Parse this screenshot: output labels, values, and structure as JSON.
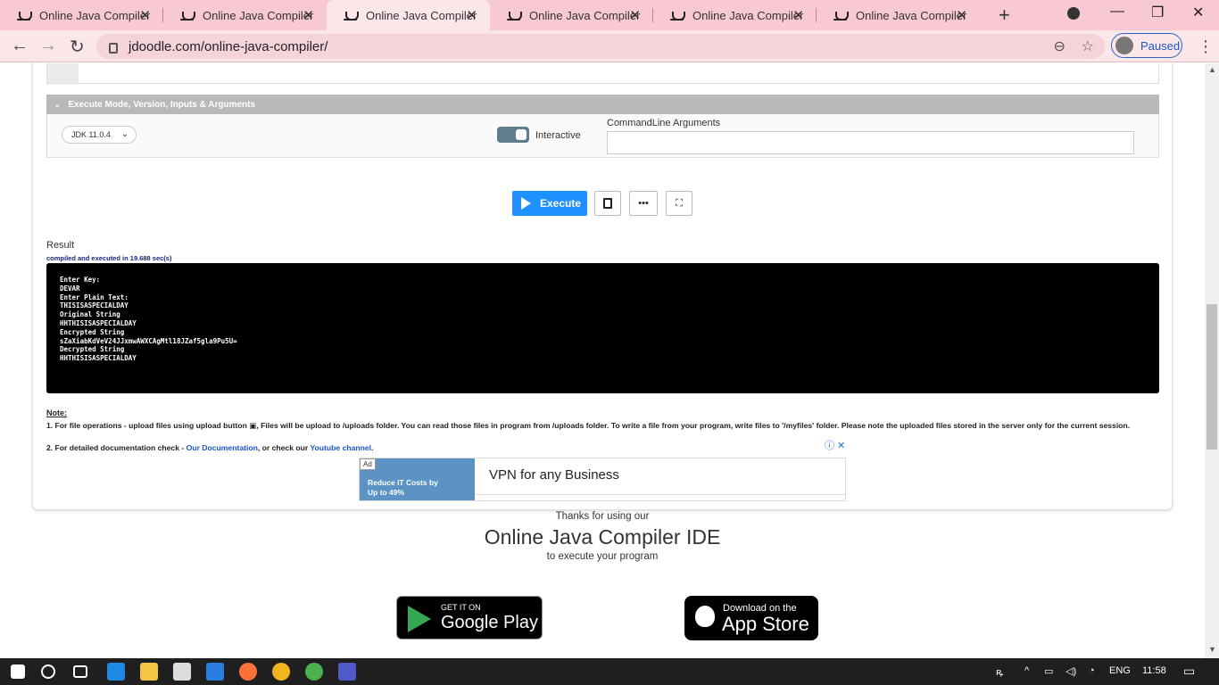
{
  "tabs": [
    {
      "label": "Online Java Compiler -",
      "active": false
    },
    {
      "label": "Online Java Compiler -",
      "active": false
    },
    {
      "label": "Online Java Compiler -",
      "active": true
    },
    {
      "label": "Online Java Compiler -",
      "active": false
    },
    {
      "label": "Online Java Compiler -",
      "active": false
    },
    {
      "label": "Online Java Compiler -",
      "active": false
    }
  ],
  "browser": {
    "url": "jdoodle.com/online-java-compiler/",
    "profile_status": "Paused",
    "new_tab": "+",
    "minimize": "—",
    "maximize": "❐",
    "close": "✕"
  },
  "execute_panel": {
    "heading": "Execute Mode, Version, Inputs & Arguments",
    "jdk_version": "JDK 11.0.4",
    "interactive_label": "Interactive",
    "interactive_on": true,
    "cmd_label": "CommandLine Arguments",
    "cmd_value": ""
  },
  "buttons": {
    "execute": "Execute",
    "more": "•••"
  },
  "result": {
    "label": "Result",
    "status": "compiled and executed in 19.688 sec(s)",
    "output_lines": [
      "Enter Key:",
      "DEVAR",
      "Enter Plain Text:",
      "THISISASPECIALDAY",
      "Original String",
      "HHTHISISASPECIALDAY",
      "Encrypted String",
      "sZaXiabKdVeV24JJxmwAWXCAgMtl18JZaf5gla9Pu5U=",
      "Decrypted String",
      "HHTHISISASPECIALDAY"
    ]
  },
  "notes": {
    "label": "Note:",
    "line1": "1. For file operations - upload files using upload button ▣, Files will be upload to /uploads folder. You can read those files in program from /uploads folder. To write a file from your program, write files to '/myfiles' folder. Please note the uploaded files stored in the server only for the current session.",
    "line2_prefix": "2. For detailed documentation check - ",
    "line2_link1": "Our Documentation",
    "line2_mid": ", or check our ",
    "line2_link2": "Youtube channel",
    "line2_suffix": "."
  },
  "ad": {
    "badge": "Ad",
    "image_text": "Reduce IT Costs by Up to 49%",
    "title": "VPN for any Business",
    "close_icons": "ⓘ ✕"
  },
  "footer": {
    "thanks": "Thanks for using our",
    "title": "Online Java Compiler IDE",
    "subtitle": "to execute your program",
    "gplay_small": "GET IT ON",
    "gplay_big": "Google Play",
    "appstore_small": "Download on the",
    "appstore_big": "App Store"
  },
  "taskbar": {
    "language": "ENG",
    "time": "11:58"
  },
  "colors": {
    "tabstrip": "#f8c8d3",
    "accent": "#1e90ff",
    "terminal_bg": "#000000"
  }
}
